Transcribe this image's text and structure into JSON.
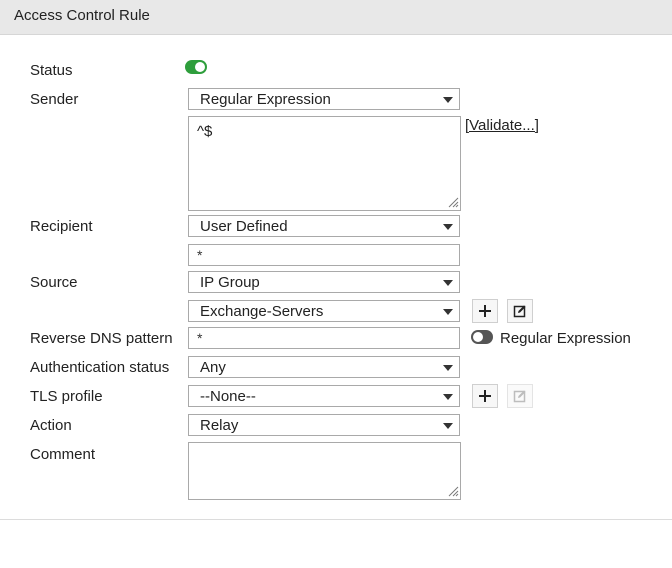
{
  "header": {
    "title": "Access Control Rule"
  },
  "fields": {
    "status": {
      "label": "Status",
      "enabled": true
    },
    "sender": {
      "label": "Sender",
      "selected": "Regular Expression",
      "expression": "^$",
      "validate_label": "[Validate...]"
    },
    "recipient": {
      "label": "Recipient",
      "selected": "User Defined",
      "value": "*"
    },
    "source": {
      "label": "Source",
      "selected": "IP Group",
      "group": "Exchange-Servers"
    },
    "reverse_dns": {
      "label": "Reverse DNS pattern",
      "value": "*",
      "regex_enabled": false,
      "regex_label": "Regular Expression"
    },
    "auth_status": {
      "label": "Authentication status",
      "selected": "Any"
    },
    "tls_profile": {
      "label": "TLS profile",
      "selected": "--None--"
    },
    "action": {
      "label": "Action",
      "selected": "Relay"
    },
    "comment": {
      "label": "Comment",
      "value": ""
    }
  },
  "icons": {
    "add": "plus-icon",
    "edit": "edit-icon",
    "toggle_on_color": "#2e9e3c",
    "toggle_off_color": "#555555"
  }
}
